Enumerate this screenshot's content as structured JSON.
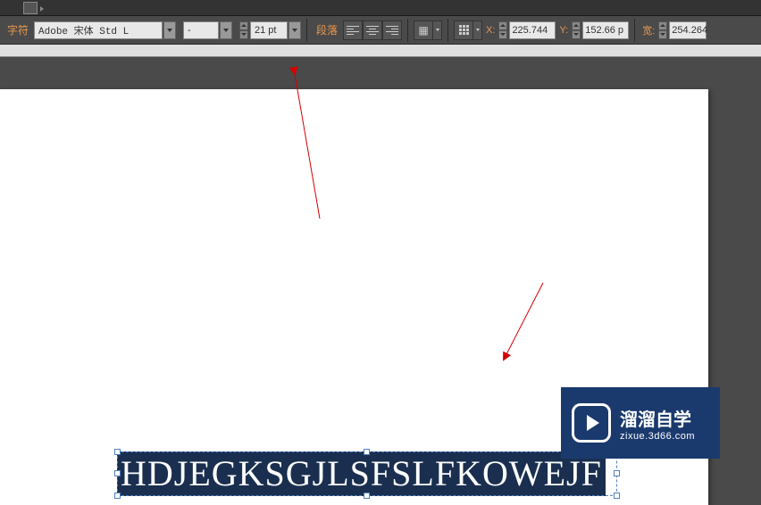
{
  "toolbar": {
    "char_label": "字符",
    "font_family": "Adobe 宋体 Std L",
    "font_style": "-",
    "font_size": "21 pt",
    "para_label": "段落"
  },
  "coords": {
    "x_label": "X:",
    "x_value": "225.744 ",
    "y_label": "Y:",
    "y_value": "152.66 p",
    "w_label": "宽:",
    "w_value": "254.264"
  },
  "canvas": {
    "text_content": "HDJEGKSGJLSFSLFKOWEJF"
  },
  "watermark": {
    "title": "溜溜自学",
    "url": "zixue.3d66.com"
  }
}
